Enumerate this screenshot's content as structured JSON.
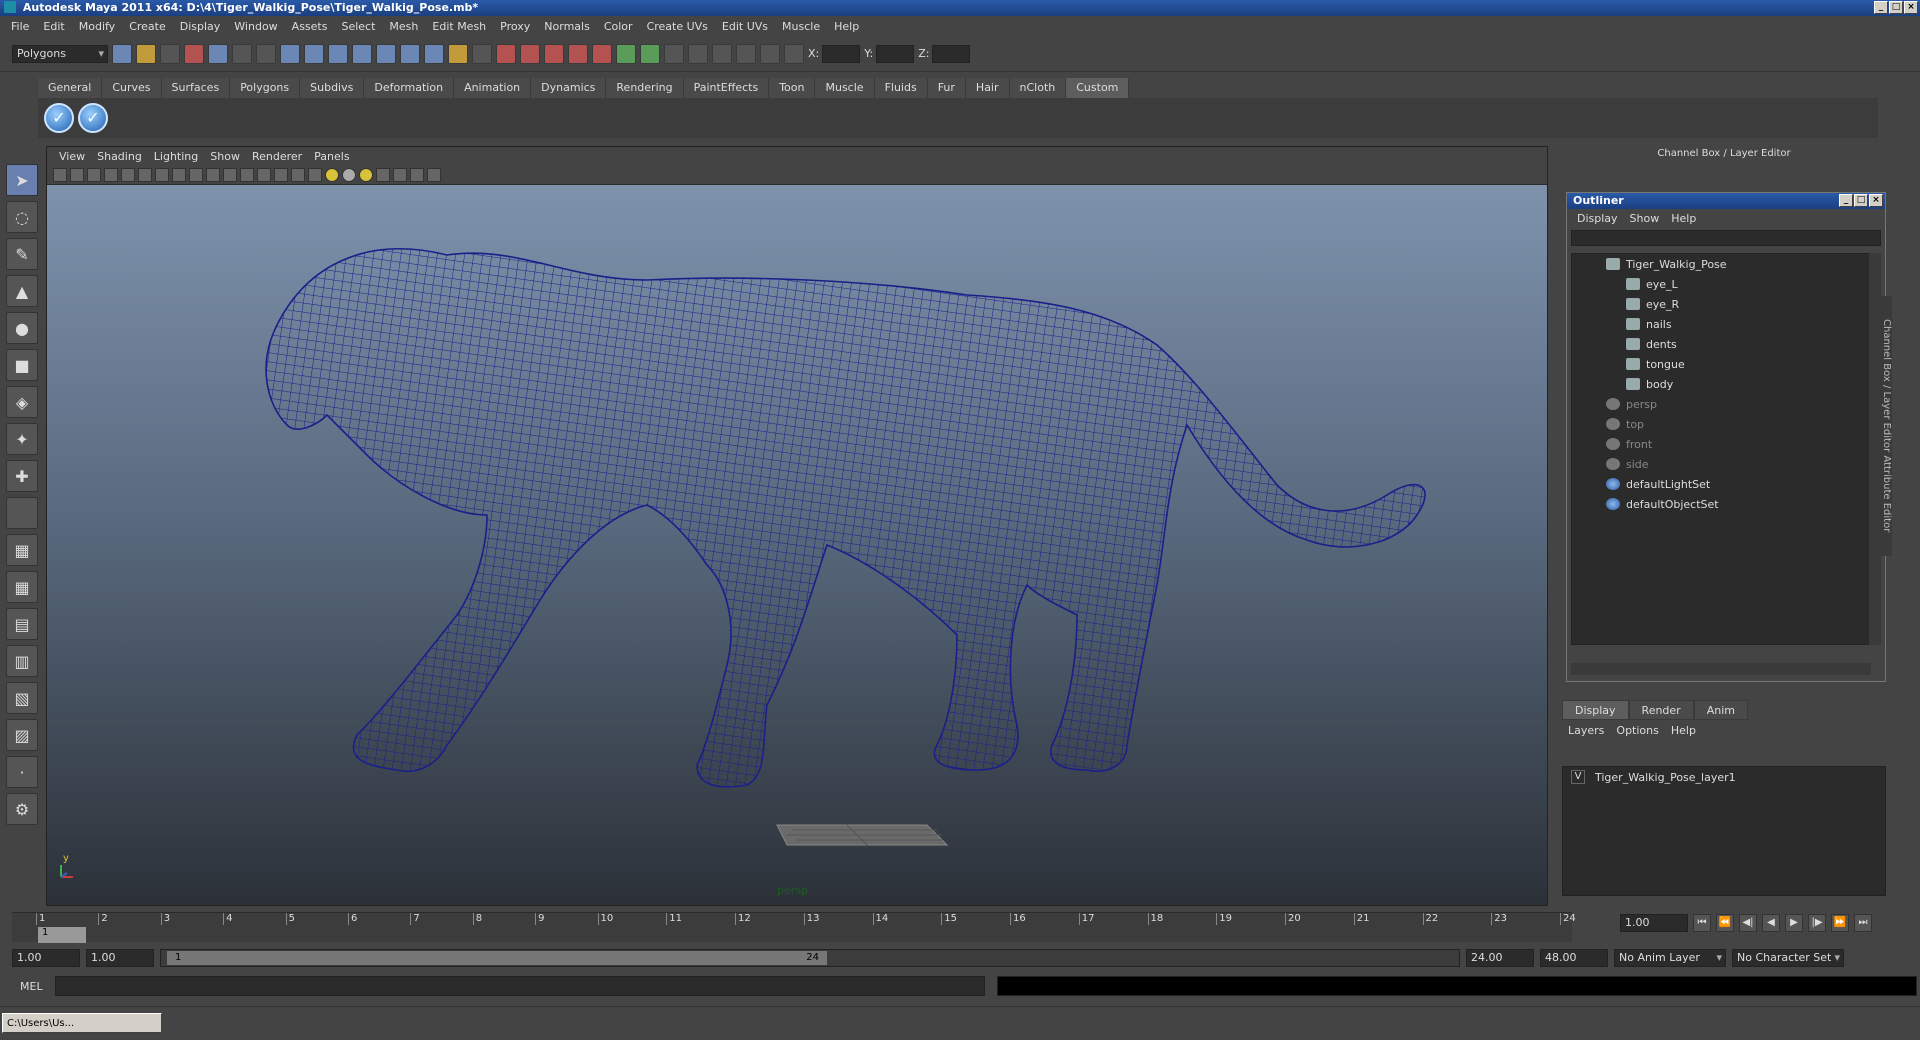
{
  "window": {
    "title": "Autodesk Maya 2011 x64: D:\\4\\Tiger_Walkig_Pose\\Tiger_Walkig_Pose.mb*"
  },
  "menubar": [
    "File",
    "Edit",
    "Modify",
    "Create",
    "Display",
    "Window",
    "Assets",
    "Select",
    "Mesh",
    "Edit Mesh",
    "Proxy",
    "Normals",
    "Color",
    "Create UVs",
    "Edit UVs",
    "Muscle",
    "Help"
  ],
  "toolbar": {
    "mode": "Polygons",
    "x_label": "X:",
    "y_label": "Y:",
    "z_label": "Z:"
  },
  "shelf": {
    "tabs": [
      "General",
      "Curves",
      "Surfaces",
      "Polygons",
      "Subdivs",
      "Deformation",
      "Animation",
      "Dynamics",
      "Rendering",
      "PaintEffects",
      "Toon",
      "Muscle",
      "Fluids",
      "Fur",
      "Hair",
      "nCloth",
      "Custom"
    ],
    "active_tab": "Custom",
    "button_glyph": "✓"
  },
  "viewport": {
    "menu": [
      "View",
      "Shading",
      "Lighting",
      "Show",
      "Renderer",
      "Panels"
    ],
    "camera_label": "persp",
    "axis_label_y": "y",
    "mesh_color": "#1a1f8a"
  },
  "channel_box": {
    "title": "Channel Box / Layer Editor"
  },
  "outliner": {
    "title": "Outliner",
    "menu": [
      "Display",
      "Show",
      "Help"
    ],
    "items": [
      {
        "label": "Tiger_Walkig_Pose",
        "indent": 0,
        "type": "group",
        "dim": false
      },
      {
        "label": "eye_L",
        "indent": 1,
        "type": "mesh",
        "dim": false
      },
      {
        "label": "eye_R",
        "indent": 1,
        "type": "mesh",
        "dim": false
      },
      {
        "label": "nails",
        "indent": 1,
        "type": "mesh",
        "dim": false
      },
      {
        "label": "dents",
        "indent": 1,
        "type": "mesh",
        "dim": false
      },
      {
        "label": "tongue",
        "indent": 1,
        "type": "mesh",
        "dim": false
      },
      {
        "label": "body",
        "indent": 1,
        "type": "mesh",
        "dim": false
      },
      {
        "label": "persp",
        "indent": 0,
        "type": "camera",
        "dim": true
      },
      {
        "label": "top",
        "indent": 0,
        "type": "camera",
        "dim": true
      },
      {
        "label": "front",
        "indent": 0,
        "type": "camera",
        "dim": true
      },
      {
        "label": "side",
        "indent": 0,
        "type": "camera",
        "dim": true
      },
      {
        "label": "defaultLightSet",
        "indent": 0,
        "type": "set",
        "dim": false
      },
      {
        "label": "defaultObjectSet",
        "indent": 0,
        "type": "set",
        "dim": false
      }
    ]
  },
  "layer_editor": {
    "tabs": [
      "Display",
      "Render",
      "Anim"
    ],
    "active_tab": "Display",
    "menu": [
      "Layers",
      "Options",
      "Help"
    ],
    "layers": [
      {
        "visible": "V",
        "name": "Tiger_Walkig_Pose_layer1"
      }
    ]
  },
  "side_tabs": "Channel Box / Layer Editor    Attribute Editor",
  "timeline": {
    "ticks": [
      "1",
      "2",
      "3",
      "4",
      "5",
      "6",
      "7",
      "8",
      "9",
      "10",
      "11",
      "12",
      "13",
      "14",
      "15",
      "16",
      "17",
      "18",
      "19",
      "20",
      "21",
      "22",
      "23",
      "24"
    ],
    "current_frame": "1",
    "current_time": "1.00"
  },
  "range": {
    "start": "1.00",
    "playback_start": "1.00",
    "handle_start": "1",
    "handle_end": "24",
    "playback_end": "24.00",
    "end": "48.00",
    "anim_layer": "No Anim Layer",
    "character_set": "No Character Set"
  },
  "command_line": {
    "label": "MEL"
  },
  "taskbar": {
    "item": "C:\\Users\\Us..."
  }
}
